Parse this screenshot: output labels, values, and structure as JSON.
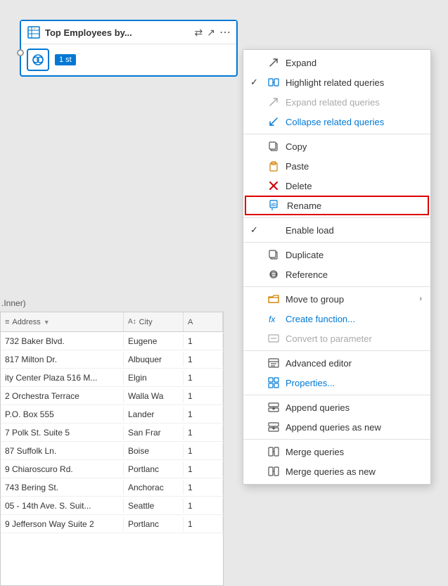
{
  "canvas": {
    "background": "#e8e8e8"
  },
  "queryCard": {
    "title": "Top Employees by...",
    "badge": "1 st",
    "actions": [
      "share",
      "expand",
      "more"
    ]
  },
  "joinLabel": ".Inner)",
  "tableHeaders": [
    {
      "label": "Address",
      "typeIcon": "≡",
      "sortIcon": "▼",
      "colClass": "col-address"
    },
    {
      "label": "City",
      "typeIcon": "A↕",
      "colClass": "col-city"
    },
    {
      "label": "A",
      "typeIcon": "",
      "colClass": "col-extra"
    }
  ],
  "tableRows": [
    {
      "address": "732 Baker Blvd.",
      "city": "Eugene",
      "extra": "1"
    },
    {
      "address": "817 Milton Dr.",
      "city": "Albuquer",
      "extra": "1"
    },
    {
      "address": "ity Center Plaza 516 M...",
      "city": "Elgin",
      "extra": "1"
    },
    {
      "address": "2 Orchestra Terrace",
      "city": "Walla Wa",
      "extra": "1"
    },
    {
      "address": "P.O. Box 555",
      "city": "Lander",
      "extra": "1"
    },
    {
      "address": "7 Polk St. Suite 5",
      "city": "San Frar",
      "extra": "1"
    },
    {
      "address": "87 Suffolk Ln.",
      "city": "Boise",
      "extra": "1"
    },
    {
      "address": "9 Chiaroscuro Rd.",
      "city": "Portlanc",
      "extra": "1"
    },
    {
      "address": "743 Bering St.",
      "city": "Anchorac",
      "extra": "1"
    },
    {
      "address": "05 - 14th Ave. S. Suit...",
      "city": "Seattle",
      "extra": "1"
    },
    {
      "address": "9 Jefferson Way Suite 2",
      "city": "Portlanc",
      "extra": "1"
    }
  ],
  "contextMenu": {
    "items": [
      {
        "id": "expand",
        "label": "Expand",
        "icon": "↗",
        "iconType": "unicode",
        "check": "",
        "disabled": false,
        "blue": false,
        "hasArrow": false
      },
      {
        "id": "highlight-related",
        "label": "Highlight related queries",
        "icon": "⇄",
        "iconType": "unicode",
        "check": "✓",
        "disabled": false,
        "blue": false,
        "hasArrow": false
      },
      {
        "id": "expand-related",
        "label": "Expand related queries",
        "icon": "↗",
        "iconType": "unicode",
        "check": "",
        "disabled": true,
        "blue": false,
        "hasArrow": false
      },
      {
        "id": "collapse-related",
        "label": "Collapse related queries",
        "icon": "↙",
        "iconType": "unicode",
        "check": "",
        "disabled": false,
        "blue": true,
        "hasArrow": false
      },
      {
        "id": "sep1",
        "type": "separator"
      },
      {
        "id": "copy",
        "label": "Copy",
        "icon": "📋",
        "iconType": "unicode",
        "check": "",
        "disabled": false,
        "blue": false,
        "hasArrow": false
      },
      {
        "id": "paste",
        "label": "Paste",
        "icon": "📂",
        "iconType": "unicode",
        "check": "",
        "disabled": false,
        "blue": false,
        "hasArrow": false
      },
      {
        "id": "delete",
        "label": "Delete",
        "icon": "✗",
        "iconType": "unicode",
        "check": "",
        "disabled": false,
        "blue": false,
        "hasArrow": false,
        "iconColor": "red"
      },
      {
        "id": "rename",
        "label": "Rename",
        "icon": "✏",
        "iconType": "unicode",
        "check": "",
        "disabled": false,
        "blue": false,
        "hasArrow": false,
        "highlighted": true
      },
      {
        "id": "sep2",
        "type": "separator"
      },
      {
        "id": "enable-load",
        "label": "Enable load",
        "icon": "",
        "iconType": "",
        "check": "✓",
        "disabled": false,
        "blue": false,
        "hasArrow": false
      },
      {
        "id": "sep3",
        "type": "separator"
      },
      {
        "id": "duplicate",
        "label": "Duplicate",
        "icon": "⧉",
        "iconType": "unicode",
        "check": "",
        "disabled": false,
        "blue": false,
        "hasArrow": false
      },
      {
        "id": "reference",
        "label": "Reference",
        "icon": "⊕",
        "iconType": "unicode",
        "check": "",
        "disabled": false,
        "blue": false,
        "hasArrow": false
      },
      {
        "id": "sep4",
        "type": "separator"
      },
      {
        "id": "move-to-group",
        "label": "Move to group",
        "icon": "📁",
        "iconType": "unicode",
        "check": "",
        "disabled": false,
        "blue": false,
        "hasArrow": true,
        "iconColor": "orange"
      },
      {
        "id": "create-function",
        "label": "Create function...",
        "icon": "𝑓𝑥",
        "iconType": "unicode",
        "check": "",
        "disabled": false,
        "blue": true,
        "hasArrow": false
      },
      {
        "id": "convert-param",
        "label": "Convert to parameter",
        "icon": "▦",
        "iconType": "unicode",
        "check": "",
        "disabled": true,
        "blue": false,
        "hasArrow": false
      },
      {
        "id": "sep5",
        "type": "separator"
      },
      {
        "id": "advanced-editor",
        "label": "Advanced editor",
        "icon": "▤",
        "iconType": "unicode",
        "check": "",
        "disabled": false,
        "blue": false,
        "hasArrow": false
      },
      {
        "id": "properties",
        "label": "Properties...",
        "icon": "⊞",
        "iconType": "unicode",
        "check": "",
        "disabled": false,
        "blue": true,
        "hasArrow": false
      },
      {
        "id": "sep6",
        "type": "separator"
      },
      {
        "id": "append-queries",
        "label": "Append queries",
        "icon": "⇩",
        "iconType": "unicode",
        "check": "",
        "disabled": false,
        "blue": false,
        "hasArrow": false
      },
      {
        "id": "append-new",
        "label": "Append queries as new",
        "icon": "⇩",
        "iconType": "unicode",
        "check": "",
        "disabled": false,
        "blue": false,
        "hasArrow": false
      },
      {
        "id": "sep7",
        "type": "separator"
      },
      {
        "id": "merge-queries",
        "label": "Merge queries",
        "icon": "⇶",
        "iconType": "unicode",
        "check": "",
        "disabled": false,
        "blue": false,
        "hasArrow": false
      },
      {
        "id": "merge-new",
        "label": "Merge queries as new",
        "icon": "⇶",
        "iconType": "unicode",
        "check": "",
        "disabled": false,
        "blue": false,
        "hasArrow": false
      }
    ]
  }
}
